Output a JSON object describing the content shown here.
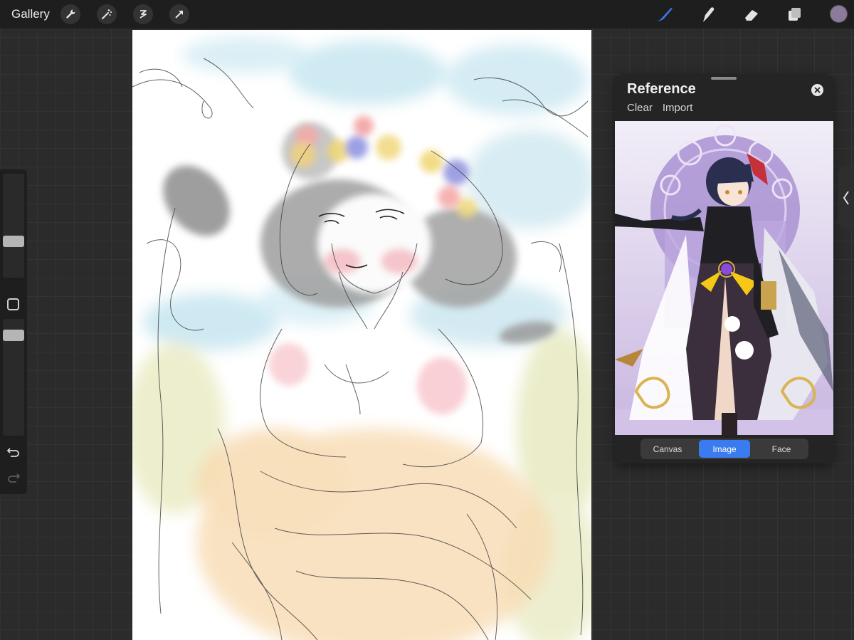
{
  "toolbar": {
    "gallery_label": "Gallery",
    "left_tools": [
      "wrench-icon",
      "magic-wand-icon",
      "selection-icon",
      "transform-arrow-icon"
    ],
    "right_tools": [
      "brush-icon",
      "smudge-icon",
      "eraser-icon",
      "layers-icon"
    ],
    "active_tool": "brush-icon",
    "accent_color": "#3a7bf0",
    "current_color": "#8c7a9a"
  },
  "sidebar": {
    "brush_size_level": 0.55,
    "opacity_level": 0.45
  },
  "reference": {
    "title": "Reference",
    "clear_label": "Clear",
    "import_label": "Import",
    "tabs": [
      {
        "label": "Canvas",
        "active": false
      },
      {
        "label": "Image",
        "active": true
      },
      {
        "label": "Face",
        "active": false
      }
    ]
  }
}
